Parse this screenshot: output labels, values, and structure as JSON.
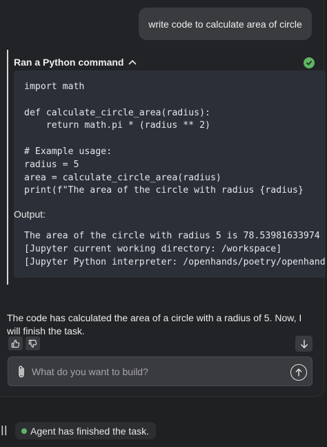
{
  "user_message": "write code to calculate area of circle",
  "command": {
    "title": "Ran a Python command",
    "code": "import math\n\ndef calculate_circle_area(radius):\n    return math.pi * (radius ** 2)\n\n# Example usage:\nradius = 5\narea = calculate_circle_area(radius)\nprint(f\"The area of the circle with radius {radius}",
    "output_label": "Output:",
    "output": "The area of the circle with radius 5 is 78.53981633974\n[Jupyter current working directory: /workspace]\n[Jupyter Python interpreter: /openhands/poetry/openhands"
  },
  "assistant_message": "The code has calculated the area of a circle with a radius of 5. Now, I will finish the task.",
  "input": {
    "placeholder": "What do you want to build?",
    "value": ""
  },
  "status": {
    "text": "Agent has finished the task.",
    "color": "#5eb562"
  },
  "icons": [
    "chevron-up-icon",
    "check-icon",
    "thumbs-up-icon",
    "thumbs-down-icon",
    "arrow-down-icon",
    "paperclip-icon",
    "arrow-up-icon",
    "pause-icon"
  ]
}
